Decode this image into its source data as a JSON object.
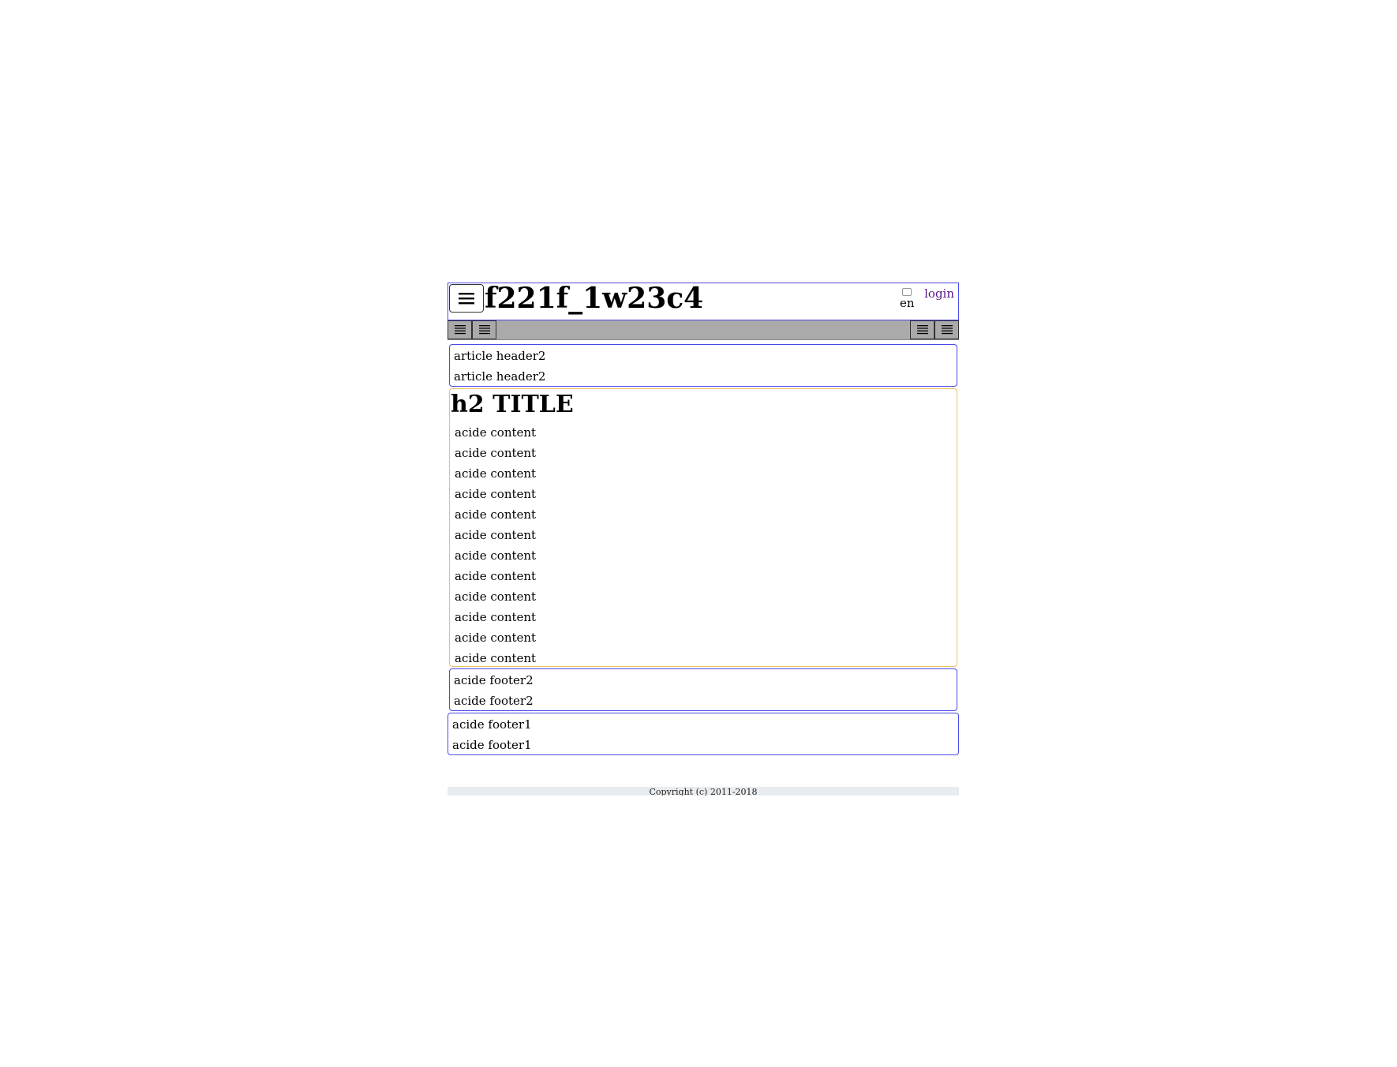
{
  "header": {
    "menu_icon": "hamburger-icon",
    "title": "f221f_1w23c4",
    "language_alt": "en",
    "login_label": "login"
  },
  "toolbar": {
    "left_buttons": [
      "list-icon",
      "list-icon"
    ],
    "right_buttons": [
      "list-icon",
      "list-icon"
    ]
  },
  "article_header": {
    "lines": [
      "article header2",
      "article header2"
    ]
  },
  "aside": {
    "title": "h2 TITLE",
    "lines": [
      "acide content",
      "acide content",
      "acide content",
      "acide content",
      "acide content",
      "acide content",
      "acide content",
      "acide content",
      "acide content",
      "acide content",
      "acide content",
      "acide content"
    ]
  },
  "aside_footer2": {
    "lines": [
      "acide footer2",
      "acide footer2"
    ]
  },
  "aside_footer1": {
    "lines": [
      "acide footer1",
      "acide footer1"
    ]
  },
  "footer": {
    "copyright": "Copyright (c) 2011-2018"
  },
  "colors": {
    "border_blue": "#4a4ae8",
    "border_orange": "#f0c060",
    "toolbar_gray": "#aaaaaa",
    "link_purple": "#5a1a8a",
    "footer_bg": "#e9ecef"
  }
}
